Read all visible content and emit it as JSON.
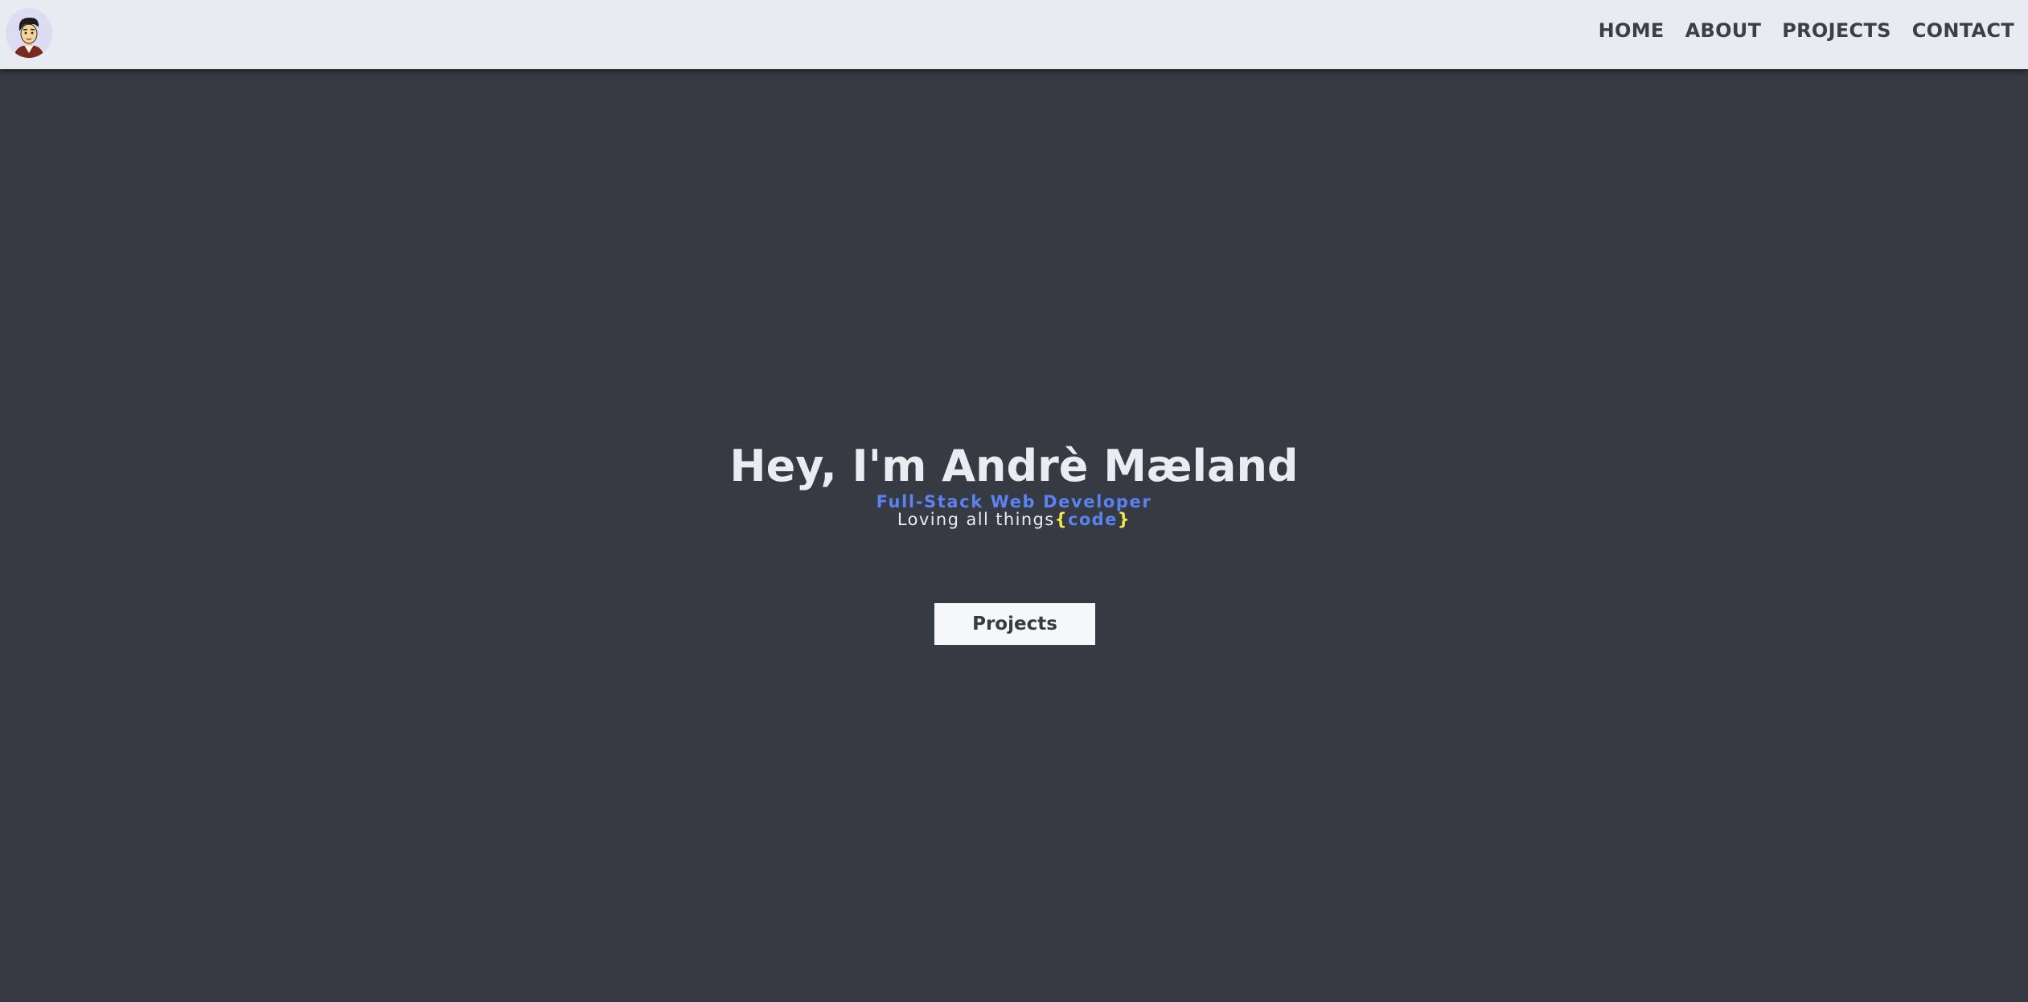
{
  "nav": {
    "avatar_icon": "cartoon-avatar-icon",
    "links": [
      "HOME",
      "ABOUT",
      "PROJECTS",
      "CONTACT"
    ]
  },
  "hero": {
    "title": "Hey, I'm Andrè Mæland",
    "subtitle": "Full-Stack Web Developer",
    "tagline_prefix": "Loving all things",
    "brace_open": "{",
    "code_word": "code",
    "brace_close": "}"
  },
  "cta": {
    "label": "Projects"
  },
  "colors": {
    "background": "#363a43",
    "navbar": "#e8ecf1",
    "accent_blue": "#5b82ef",
    "accent_yellow": "#f2e64a",
    "text_light": "#e9edf2"
  }
}
